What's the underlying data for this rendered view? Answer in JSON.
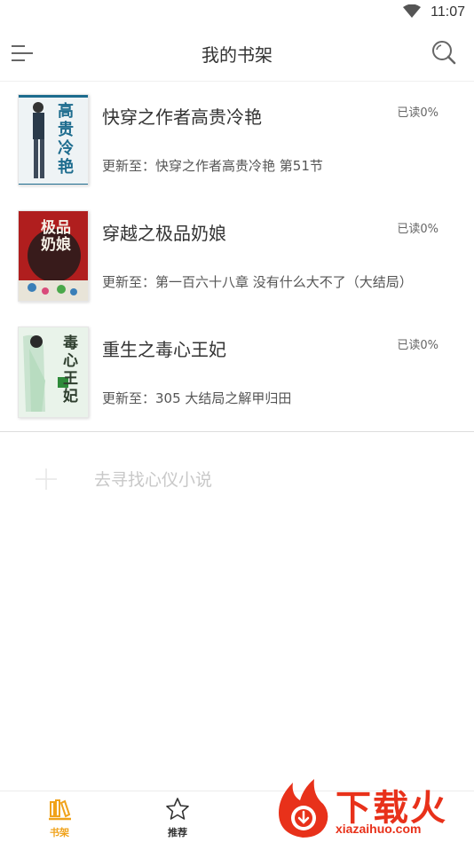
{
  "status_bar": {
    "time": "11:07"
  },
  "header": {
    "title": "我的书架"
  },
  "books": [
    {
      "title": "快穿之作者高贵冷艳",
      "progress": "已读0%",
      "update_prefix": "更新至：",
      "update_text": "快穿之作者高贵冷艳 第51节",
      "cover_text": "高贵冷艳",
      "cover_colors": {
        "bg": "#eef3f5",
        "accent": "#1d6c8e"
      }
    },
    {
      "title": "穿越之极品奶娘",
      "progress": "已读0%",
      "update_prefix": "更新至：",
      "update_text": "第一百六十八章 没有什么大不了（大结局）",
      "cover_text": "极品奶娘",
      "cover_colors": {
        "bg": "#b01e1e",
        "accent": "#1a1a1a"
      }
    },
    {
      "title": "重生之毒心王妃",
      "progress": "已读0%",
      "update_prefix": "更新至：",
      "update_text": "305 大结局之解甲归田",
      "cover_text": "毒心王妃",
      "cover_colors": {
        "bg": "#e9f3ea",
        "accent": "#2e3e2e"
      }
    }
  ],
  "find_novel": {
    "label": "去寻找心仪小说"
  },
  "bottom_nav": [
    {
      "label": "书架",
      "icon": "bookshelf-icon",
      "active": true
    },
    {
      "label": "推荐",
      "icon": "star-icon",
      "active": false
    },
    {
      "label": "",
      "icon": "discover-icon",
      "active": false
    }
  ],
  "watermark": {
    "brand": "下载火",
    "url": "xiazaihuo.com"
  },
  "colors": {
    "accent": "#f0a21a",
    "watermark": "#e8311a"
  }
}
